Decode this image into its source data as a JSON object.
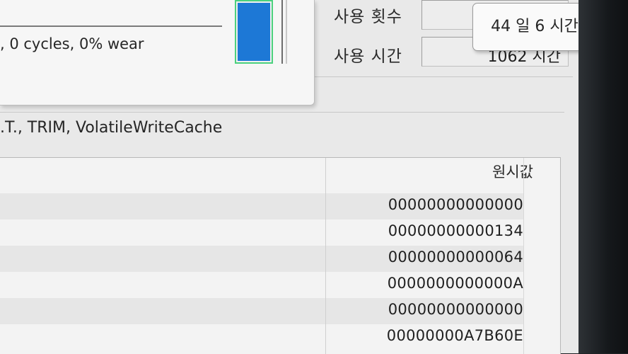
{
  "popup": {
    "wear_text": ", 0 cycles, 0% wear",
    "wear_bar_percent": 100
  },
  "info": {
    "power_on_count_label": "사용 횟수",
    "power_on_count_value": "",
    "power_on_hours_label": "사용 시간",
    "power_on_hours_value": "1062 시간",
    "tooltip": "44 일 6 시간"
  },
  "features_text": ".T., TRIM, VolatileWriteCache",
  "table": {
    "raw_header": "원시값",
    "rows": [
      {
        "raw": "00000000000000"
      },
      {
        "raw": "00000000000134"
      },
      {
        "raw": "00000000000064"
      },
      {
        "raw": "0000000000000A"
      },
      {
        "raw": "00000000000000"
      },
      {
        "raw": "00000000A7B60E"
      }
    ]
  },
  "colors": {
    "bar_fill": "#1d78d6",
    "bar_border": "#4bd17e"
  }
}
